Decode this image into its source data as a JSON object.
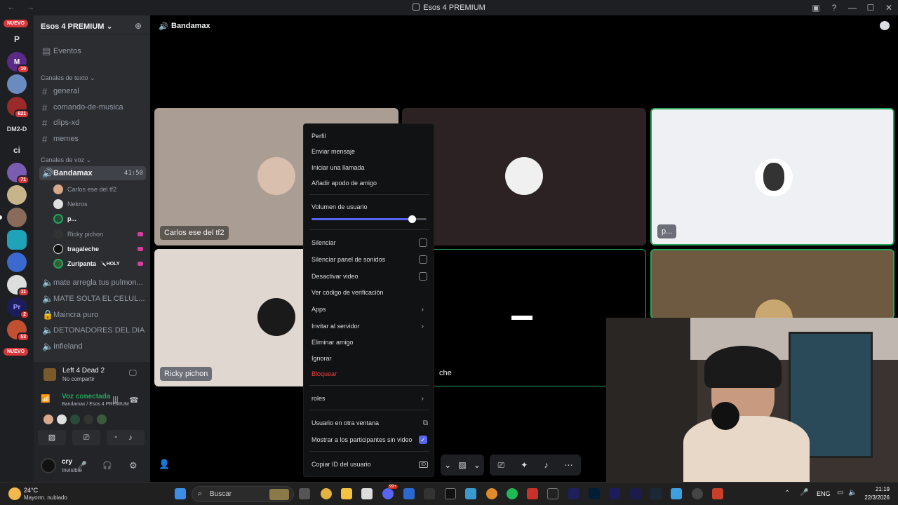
{
  "window": {
    "title": "Esos 4 PREMIUM",
    "nav": "← →",
    "controls": [
      "▣",
      "?",
      "—",
      "☐",
      "✕"
    ]
  },
  "rail": {
    "nuevo_top": "NUEVO",
    "p_label": "P",
    "badge_10": "10",
    "badge_621": "621",
    "dm_label": "DM2-D",
    "ci_label": "ci",
    "badge_71": "71",
    "badge_11": "11",
    "badge_2": "2",
    "badge_53": "53",
    "nuevo_bottom": "NUEVO"
  },
  "sidebar": {
    "server_name": "Esos 4 PREMIUM ⌄",
    "events": "Eventos",
    "text_category": "Canales de texto ⌄",
    "text_channels": [
      "general",
      "comando-de-musica",
      "clips-xd",
      "memes"
    ],
    "voice_category": "Canales de voz ⌄",
    "active_voice": {
      "name": "Bandamax",
      "time": "41:50"
    },
    "voice_users": [
      {
        "name": "Carlos ese del tf2"
      },
      {
        "name": "Nekros"
      },
      {
        "name": "p..."
      },
      {
        "name": "Ricky pichon"
      },
      {
        "name": "tragaleche"
      },
      {
        "name": "Zuripanta",
        "role": "🔪HOLY"
      }
    ],
    "voice_channels": [
      "mate arregla tus pulmon...",
      "MATE SOLTA EL CELUL...",
      "Maincra puro",
      "DETONADORES DEL DIA",
      "Infieland"
    ]
  },
  "activity": {
    "game": "Left 4 Dead 2",
    "status": "No compartir"
  },
  "voice_status": {
    "label": "Voz conectada",
    "location": "Bandamax / Esos 4 PREMIUM"
  },
  "user": {
    "name": "cry",
    "status": "Invisible"
  },
  "main": {
    "channel": "Bandamax",
    "tiles": [
      {
        "name": "Carlos ese del tf2"
      },
      {
        "name": "p..."
      },
      {
        "name": "Ricky pichon"
      },
      {
        "name": "che"
      }
    ]
  },
  "context_menu": {
    "profile": "Perfil",
    "send_message": "Enviar mensaje",
    "start_call": "Iniciar una llamada",
    "add_nickname": "Añadir apodo de amigo",
    "user_volume": "Volumen de usuario",
    "volume_level": 0.87,
    "mute": "Silenciar",
    "mute_soundboard": "Silenciar panel de sonidos",
    "disable_video": "Desactivar video",
    "verification_code": "Ver código de verificación",
    "apps": "Apps",
    "invite_server": "Invitar al servidor",
    "remove_friend": "Eliminar amigo",
    "ignore": "Ignorar",
    "block": "Bloquear",
    "roles": "roles",
    "popout": "Usuario en otra ventana",
    "show_non_video": "Mostrar a los participantes sin video",
    "copy_id": "Copiar ID del usuario",
    "id_badge": "ID"
  },
  "taskbar": {
    "weather_temp": "24°C",
    "weather_desc": "Mayorm. nublado",
    "search": "Buscar",
    "lang": "ENG",
    "time": "21:19",
    "date": "22/3/2026",
    "badge": "99+"
  },
  "colors": {
    "accent": "#5865f2",
    "danger": "#da373c",
    "online": "#23a55a"
  }
}
